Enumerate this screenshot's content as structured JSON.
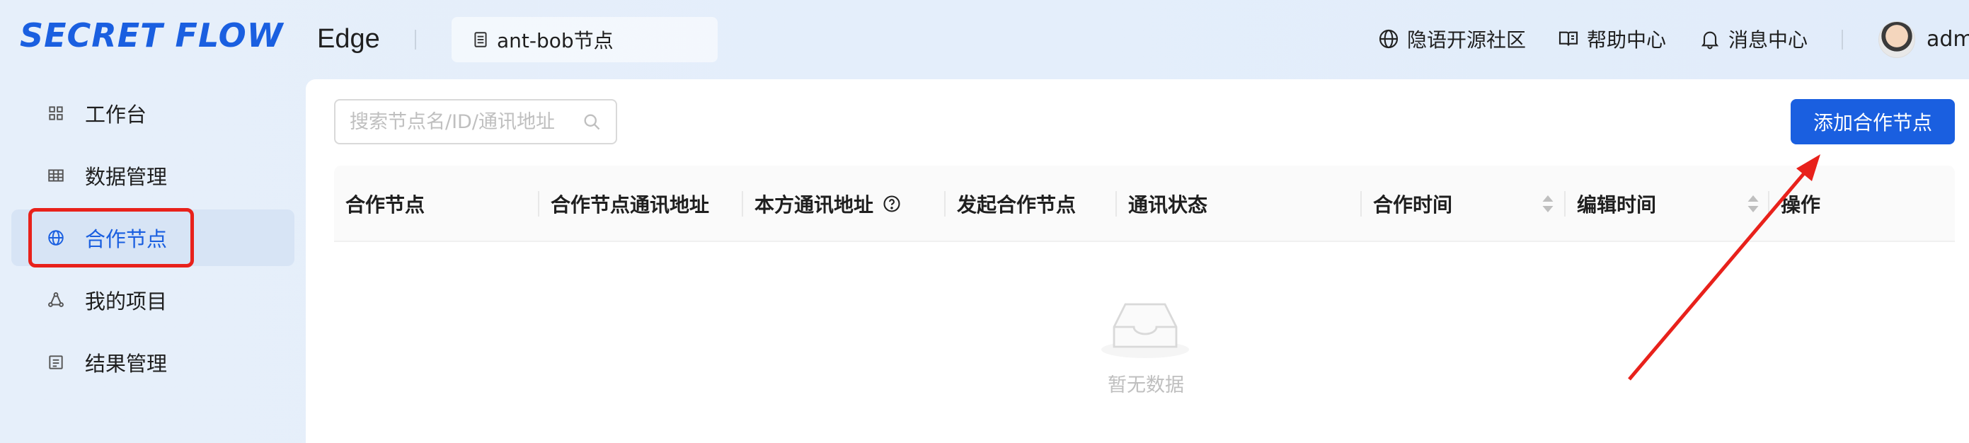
{
  "brand": {
    "logo_text": "SECRET FLOW",
    "app_name": "Edge",
    "accent": "#1a5fe0"
  },
  "header": {
    "node_selector": "ant-bob节点",
    "links": [
      {
        "label": "隐语开源社区",
        "icon": "globe-icon"
      },
      {
        "label": "帮助中心",
        "icon": "book-icon"
      },
      {
        "label": "消息中心",
        "icon": "bell-icon"
      }
    ],
    "username": "adm"
  },
  "sidebar": {
    "items": [
      {
        "label": "工作台",
        "icon": "grid-icon"
      },
      {
        "label": "数据管理",
        "icon": "table-icon"
      },
      {
        "label": "合作节点",
        "icon": "globe-icon",
        "active": true
      },
      {
        "label": "我的项目",
        "icon": "cycle-icon"
      },
      {
        "label": "结果管理",
        "icon": "list-icon"
      }
    ]
  },
  "main": {
    "search_placeholder": "搜索节点名/ID/通讯地址",
    "add_button": "添加合作节点",
    "columns": [
      "合作节点",
      "合作节点通讯地址",
      "本方通讯地址",
      "发起合作节点",
      "通讯状态",
      "合作时间",
      "编辑时间",
      "操作"
    ],
    "empty_text": "暂无数据"
  },
  "colors": {
    "primary": "#1a5fe0",
    "annotation": "#e8211b"
  }
}
